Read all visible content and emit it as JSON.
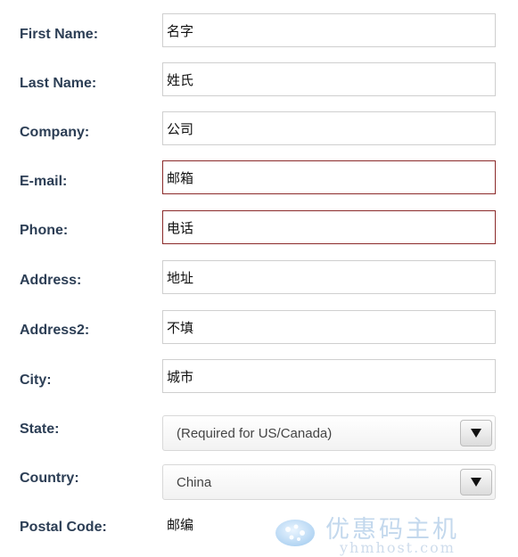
{
  "form": {
    "first_name": {
      "label": "First Name:",
      "value": "名字"
    },
    "last_name": {
      "label": "Last Name:",
      "value": "姓氏"
    },
    "company": {
      "label": "Company:",
      "value": "公司"
    },
    "email": {
      "label": "E-mail:",
      "value": "邮箱",
      "state": "error"
    },
    "phone": {
      "label": "Phone:",
      "value": "电话",
      "state": "error"
    },
    "address": {
      "label": "Address:",
      "value": "地址"
    },
    "address2": {
      "label": "Address2:",
      "value": "不填"
    },
    "city": {
      "label": "City:",
      "value": "城市"
    },
    "state": {
      "label": "State:",
      "selected": "(Required for US/Canada)"
    },
    "country": {
      "label": "Country:",
      "selected": "China"
    },
    "postal_code": {
      "label": "Postal Code:",
      "value": "邮编"
    }
  },
  "watermark": {
    "title": "优惠码主机",
    "url": "yhmhost.com"
  },
  "colors": {
    "label_text": "#2c3e55",
    "error_border": "#8b2a2a",
    "field_border": "#cfcfcf"
  },
  "icons": {
    "dropdown": "chevron-down-icon"
  }
}
